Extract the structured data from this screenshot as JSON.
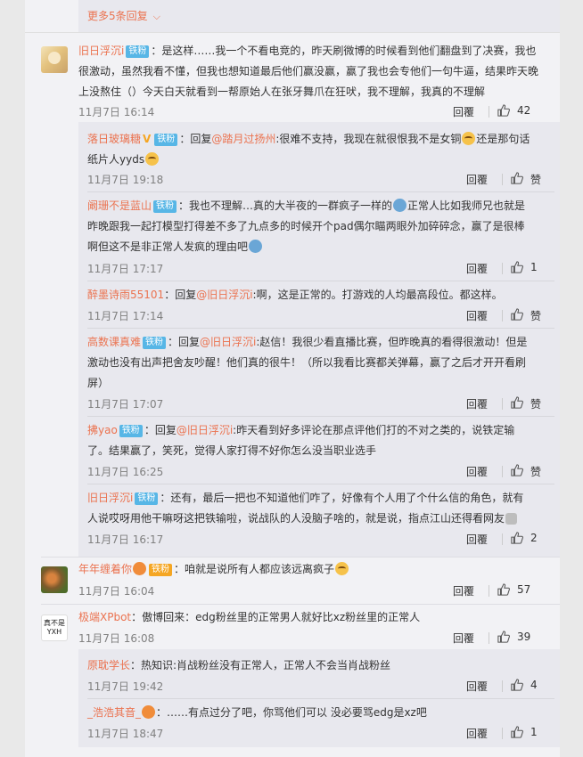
{
  "more_replies": "更多5条回复",
  "reply_label": "回覆",
  "comments": [
    {
      "name": "旧日浮沉i",
      "badge": "铁粉",
      "text": "：是这样……我一个不看电竞的，昨天刷微博的时候看到他们翻盘到了决赛，我也很激动，虽然我看不懂，但我也想知道最后他们赢没赢，赢了我也会专他们一句牛逼，结果昨天晚上没熬住（）今天白天就看到一帮原始人在张牙舞爪在狂吠，我不理解，我真的不理解",
      "time": "11月7日 16:14",
      "likes": "42",
      "replies": [
        {
          "name": "落日玻璃糖",
          "badge": "铁粉",
          "prefix": "：回复",
          "mention": "@踏月过扬州",
          "text": ":很难不支持，我现在就很恨我不是女铜",
          "text2": "还是那句话纸片人yyds",
          "time": "11月7日 19:18",
          "likes": "赞"
        },
        {
          "name": "阚珊不是蓝山",
          "badge": "铁粉",
          "text": "：我也不理解…真的大半夜的一群疯子一样的",
          "text2": "正常人比如我师兄也就是昨晚跟我一起打模型打得差不多了九点多的时候开个pad偶尔瞄两眼外加碎碎念，赢了是很棒啊但这不是非正常人发疯的理由吧",
          "time": "11月7日 17:17",
          "likes": "1"
        },
        {
          "name": "醉墨诗雨55101",
          "prefix": "：回复",
          "mention": "@旧日浮沉i",
          "text": ":啊，这是正常的。打游戏的人均最高段位。都这样。",
          "time": "11月7日 17:14",
          "likes": "赞"
        },
        {
          "name": "高数课真难",
          "badge": "铁粉",
          "prefix": "：回复",
          "mention": "@旧日浮沉i",
          "text": ":赵信！我很少看直播比赛，但昨晚真的看得很激动！但是激动也没有出声把舍友吵醒！他们真的很牛！（所以我看比赛都关弹幕，赢了之后才开开看刷屏）",
          "time": "11月7日 17:07",
          "likes": "赞"
        },
        {
          "name": "拂yao",
          "badge": "铁粉",
          "prefix": "：回复",
          "mention": "@旧日浮沉i",
          "text": ":昨天看到好多评论在那点评他们打的不对之类的，说铁定输了。结果赢了，笑死，觉得人家打得不好你怎么没当职业选手",
          "time": "11月7日 16:25",
          "likes": "赞"
        },
        {
          "name": "旧日浮沉i",
          "badge": "铁粉",
          "text": "：还有，最后一把也不知道他们咋了，好像有个人用了个什么信的角色，就有人说哎呀用他干嘛呀这把铁输啦，说战队的人没脑子啥的，就是说，指点江山还得看网友",
          "time": "11月7日 16:17",
          "likes": "2"
        }
      ]
    },
    {
      "name": "年年缠着你",
      "badge": "铁粉",
      "text": "：咱就是说所有人都应该远离疯子",
      "time": "11月7日 16:04",
      "likes": "57"
    },
    {
      "name": "极端XPbot",
      "avatar_text": "真不是 YXH",
      "text": "：傲博回来：edg粉丝里的正常男人就好比xz粉丝里的正常人",
      "time": "11月7日 16:08",
      "likes": "39",
      "replies": [
        {
          "name": "原耽学长",
          "text": "：热知识:肖战粉丝没有正常人，正常人不会当肖战粉丝",
          "time": "11月7日 19:42",
          "likes": "4"
        },
        {
          "name": "_浩浩其音_",
          "text": "：……有点过分了吧，你骂他们可以 没必要骂edg是xz吧",
          "time": "11月7日 18:47",
          "likes": "1"
        }
      ]
    }
  ],
  "colors": {
    "accent": "#eb7350",
    "badge": "#57b6e6",
    "background": "#e9e9e9"
  },
  "icons": {
    "like": "thumbs-up-icon",
    "expand": "chevron-down-icon"
  }
}
